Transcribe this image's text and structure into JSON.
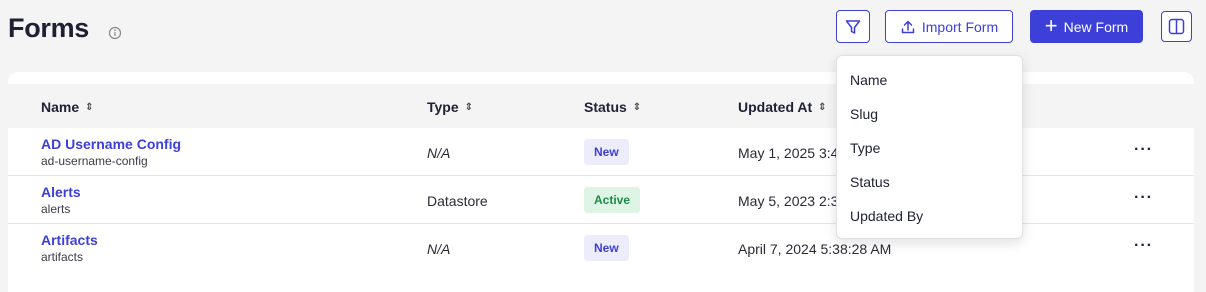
{
  "header": {
    "title": "Forms",
    "info_icon": "info-icon",
    "filter_icon": "filter-icon",
    "import_label": "Import Form",
    "import_icon": "upload-icon",
    "new_label": "New Form",
    "new_icon": "plus-icon",
    "layout_icon": "columns-layout-icon"
  },
  "table": {
    "columns": [
      "Name",
      "Type",
      "Status",
      "Updated At"
    ],
    "rows": [
      {
        "name": "AD Username Config",
        "slug": "ad-username-config",
        "type": "N/A",
        "status": "New",
        "updated": "May 1, 2025 3:4"
      },
      {
        "name": "Alerts",
        "slug": "alerts",
        "type": "Datastore",
        "status": "Active",
        "updated": "May 5, 2023 2:3"
      },
      {
        "name": "Artifacts",
        "slug": "artifacts",
        "type": "N/A",
        "status": "New",
        "updated": "April 7, 2024 5:38:28 AM"
      }
    ],
    "row_action": "···"
  },
  "filter_menu": {
    "items": [
      "Name",
      "Slug",
      "Type",
      "Status",
      "Updated By"
    ]
  },
  "colors": {
    "accent": "#3d3fd9",
    "badge_new_bg": "#ececfb",
    "badge_active_bg": "#def5e6",
    "badge_active_text": "#1e8a47"
  }
}
